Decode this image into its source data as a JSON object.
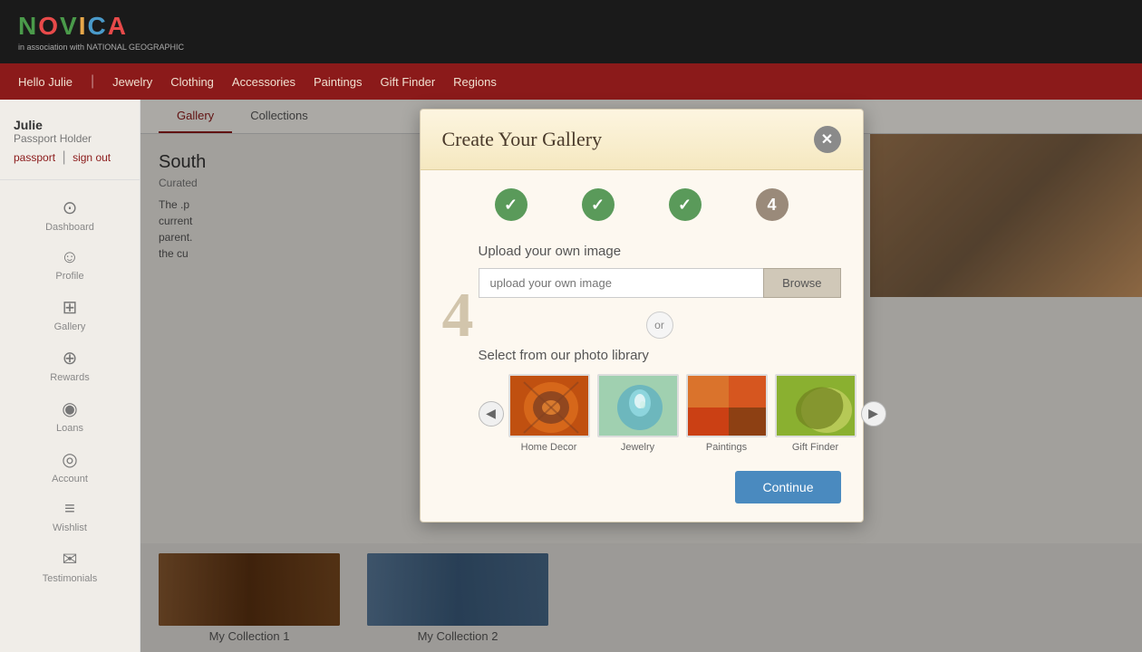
{
  "header": {
    "logo_text": "NOVICA",
    "logo_sub": "in association with NATIONAL GEOGRAPHIC"
  },
  "navbar": {
    "greeting": "Hello Julie",
    "divider": "|",
    "items": [
      {
        "label": "Jewelry"
      },
      {
        "label": "Clothing"
      },
      {
        "label": "Accessories"
      },
      {
        "label": "Paintings"
      },
      {
        "label": "Gift Finder"
      },
      {
        "label": "Regions"
      }
    ]
  },
  "sidebar": {
    "user": {
      "name": "Julie",
      "role": "Passport Holder",
      "passport_link": "passport",
      "signout_link": "sign out"
    },
    "items": [
      {
        "label": "Dashboard",
        "icon": "⊙"
      },
      {
        "label": "Profile",
        "icon": "☺"
      },
      {
        "label": "Gallery",
        "icon": "⊞"
      },
      {
        "label": "Rewards",
        "icon": "⊕"
      },
      {
        "label": "Loans",
        "icon": "◉"
      },
      {
        "label": "Account",
        "icon": "◎"
      },
      {
        "label": "Wishlist",
        "icon": "≡"
      },
      {
        "label": "Testimonials",
        "icon": "✉"
      }
    ]
  },
  "tabs": [
    {
      "label": "Gallery",
      "active": true
    },
    {
      "label": "Collections",
      "active": false
    }
  ],
  "page": {
    "title": "South",
    "subtitle": "Curated",
    "description": "The .p current parent. the cu"
  },
  "modal": {
    "title": "Create Your Gallery",
    "close_label": "✕",
    "steps": [
      {
        "number": "✓",
        "state": "completed"
      },
      {
        "number": "✓",
        "state": "completed"
      },
      {
        "number": "✓",
        "state": "completed"
      },
      {
        "number": "4",
        "state": "active"
      }
    ],
    "step4_big": "4",
    "upload_section": {
      "label": "Upload your own image",
      "input_placeholder": "upload your own image",
      "browse_label": "Browse"
    },
    "or_text": "or",
    "library_section": {
      "label": "Select from our photo library",
      "prev_arrow": "◀",
      "next_arrow": "▶",
      "photos": [
        {
          "label": "Home Decor",
          "type": "home-decor"
        },
        {
          "label": "Jewelry",
          "type": "jewelry"
        },
        {
          "label": "Paintings",
          "type": "paintings"
        },
        {
          "label": "Gift Finder",
          "type": "gift-finder"
        }
      ]
    },
    "continue_label": "Continue"
  },
  "collections": [
    {
      "title": "My Collection 1"
    },
    {
      "title": "My Collection 2"
    }
  ]
}
